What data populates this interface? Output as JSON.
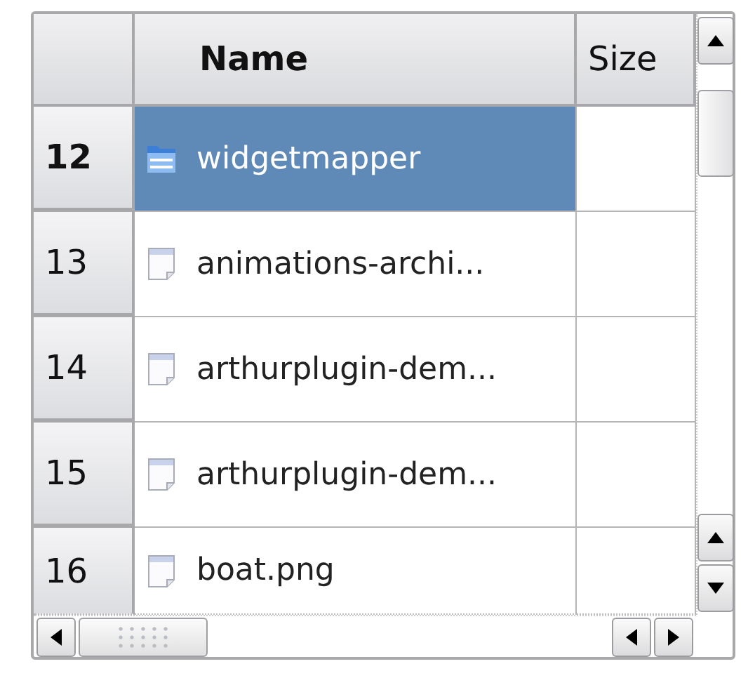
{
  "table": {
    "columns": [
      {
        "label": "Name",
        "bold": true
      },
      {
        "label": "Size",
        "bold": false
      }
    ],
    "rows": [
      {
        "number": "12",
        "name": "widgetmapper",
        "kind": "folder",
        "selected": true
      },
      {
        "number": "13",
        "name": "animations-archi...",
        "kind": "file",
        "selected": false
      },
      {
        "number": "14",
        "name": "arthurplugin-dem...",
        "kind": "file",
        "selected": false
      },
      {
        "number": "15",
        "name": "arthurplugin-dem...",
        "kind": "file",
        "selected": false
      },
      {
        "number": "16",
        "name": "boat.png",
        "kind": "file",
        "selected": false
      }
    ]
  }
}
